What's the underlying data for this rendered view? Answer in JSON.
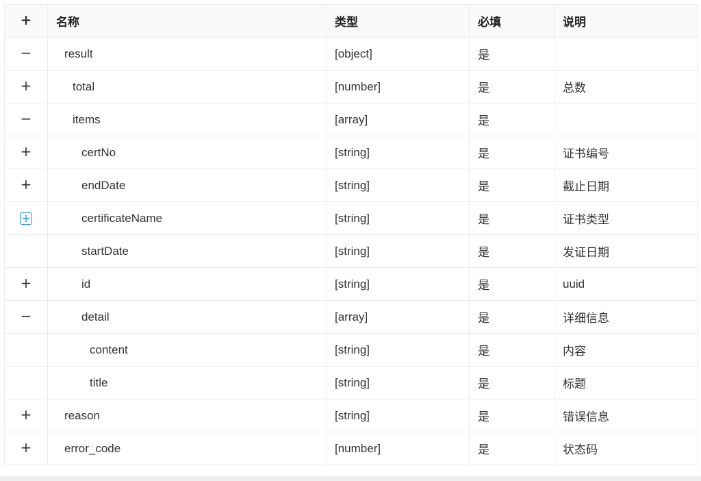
{
  "table": {
    "headers": {
      "toggle": "+",
      "name": "名称",
      "type": "类型",
      "required": "必填",
      "desc": "说明"
    },
    "rows": [
      {
        "toggle": "−",
        "name": "result",
        "type": "[object]",
        "required": "是",
        "desc": ""
      },
      {
        "toggle": "+",
        "name": "total",
        "type": "[number]",
        "required": "是",
        "desc": "总数"
      },
      {
        "toggle": "−",
        "name": "items",
        "type": "[array]",
        "required": "是",
        "desc": ""
      },
      {
        "toggle": "+",
        "name": "certNo",
        "type": "[string]",
        "required": "是",
        "desc": "证书编号"
      },
      {
        "toggle": "+",
        "name": "endDate",
        "type": "[string]",
        "required": "是",
        "desc": "截止日期"
      },
      {
        "toggle": "+",
        "name": "certificateName",
        "type": "[string]",
        "required": "是",
        "desc": "证书类型"
      },
      {
        "toggle": "",
        "name": "startDate",
        "type": "[string]",
        "required": "是",
        "desc": "发证日期"
      },
      {
        "toggle": "+",
        "name": "id",
        "type": "[string]",
        "required": "是",
        "desc": "uuid"
      },
      {
        "toggle": "−",
        "name": "detail",
        "type": "[array]",
        "required": "是",
        "desc": "详细信息"
      },
      {
        "toggle": "",
        "name": "content",
        "type": "[string]",
        "required": "是",
        "desc": "内容"
      },
      {
        "toggle": "",
        "name": "title",
        "type": "[string]",
        "required": "是",
        "desc": "标题"
      },
      {
        "toggle": "+",
        "name": "reason",
        "type": "[string]",
        "required": "是",
        "desc": "错误信息"
      },
      {
        "toggle": "+",
        "name": "error_code",
        "type": "[number]",
        "required": "是",
        "desc": "状态码"
      }
    ]
  }
}
